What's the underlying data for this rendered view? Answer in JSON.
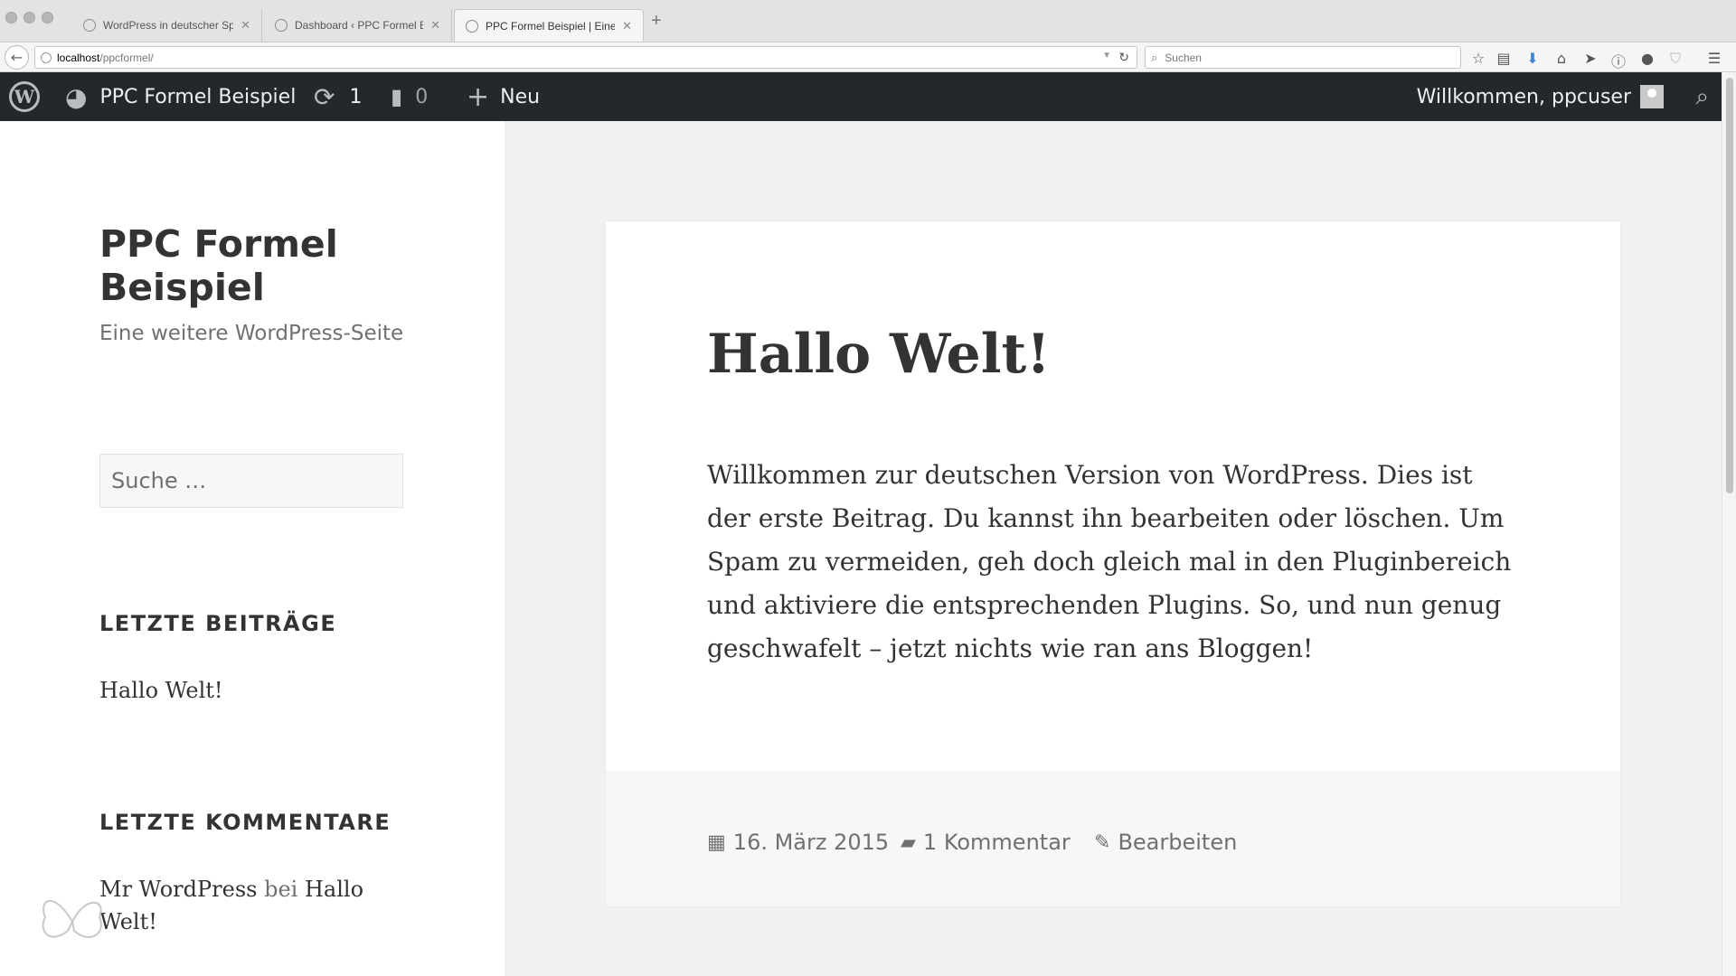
{
  "browser": {
    "tabs": [
      {
        "title": "WordPress in deutscher Spr...",
        "active": false
      },
      {
        "title": "Dashboard ‹ PPC Formel B...",
        "active": false
      },
      {
        "title": "PPC Formel Beispiel | Eine ...",
        "active": true
      }
    ],
    "new_tab_glyph": "+",
    "url_host": "localhost",
    "url_path": "/ppcformel/",
    "search_placeholder": "Suchen"
  },
  "adminbar": {
    "site_name": "PPC Formel Beispiel",
    "updates_count": "1",
    "comments_count": "0",
    "new_label": "Neu",
    "greeting": "Willkommen, ppcuser"
  },
  "sidebar": {
    "site_title": "PPC Formel Beispiel",
    "tagline": "Eine weitere WordPress-Seite",
    "search_placeholder": "Suche …",
    "recent_posts_title": "LETZTE BEITRÄGE",
    "recent_posts": [
      "Hallo Welt!"
    ],
    "recent_comments_title": "LETZTE KOMMENTARE",
    "recent_comment": {
      "author": "Mr WordPress",
      "connector": "bei",
      "post": "Hallo Welt!"
    }
  },
  "post": {
    "title": "Hallo Welt!",
    "content": "Willkommen zur deutschen Version von WordPress. Dies ist der erste Beitrag. Du kannst ihn bearbeiten oder löschen. Um Spam zu vermeiden, geh doch gleich mal in den Pluginbereich und aktiviere die entsprechenden Plugins. So, und nun genug geschwafelt – jetzt nichts wie ran ans Bloggen!",
    "date": "16. März 2015",
    "comments": "1 Kommentar",
    "edit": "Bearbeiten"
  },
  "colors": {
    "adminbar_bg": "#23282d",
    "text": "#333333",
    "muted": "#707070",
    "page_bg": "#f1f1f1"
  }
}
